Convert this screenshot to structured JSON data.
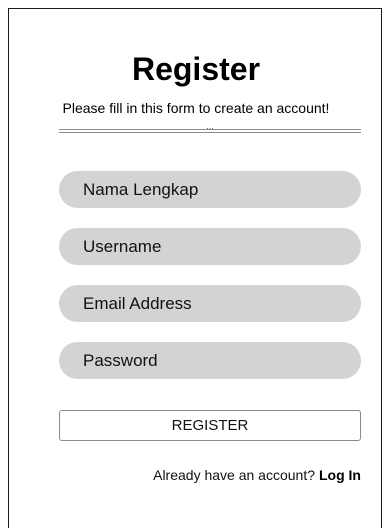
{
  "page": {
    "title": "Register",
    "subtitle": "Please fill in this form to create an account!",
    "divider_text": "..."
  },
  "form": {
    "fields": [
      {
        "placeholder": "Nama Lengkap",
        "value": ""
      },
      {
        "placeholder": "Username",
        "value": ""
      },
      {
        "placeholder": "Email Address",
        "value": ""
      },
      {
        "placeholder": "Password",
        "value": ""
      }
    ],
    "submit_label": "REGISTER"
  },
  "footer": {
    "prompt": "Already have an account?",
    "link_label": "Log In"
  },
  "colors": {
    "field_background": "#d3d3d3",
    "border": "#1a1a1a",
    "text": "#111111"
  }
}
